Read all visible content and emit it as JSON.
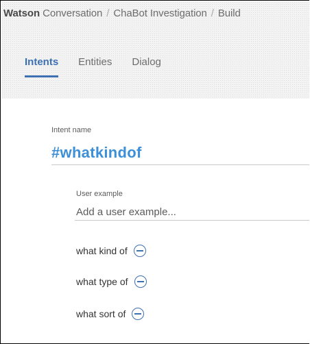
{
  "breadcrumb": {
    "brand": "Watson",
    "product": "Conversation",
    "separator": "/",
    "workspace": "ChaBot Investigation",
    "page": "Build"
  },
  "tabs": [
    {
      "label": "Intents",
      "active": true
    },
    {
      "label": "Entities",
      "active": false
    },
    {
      "label": "Dialog",
      "active": false
    }
  ],
  "intent": {
    "label": "Intent name",
    "name": "#whatkindof"
  },
  "user_example": {
    "label": "User example",
    "placeholder": "Add a user example...",
    "value": ""
  },
  "examples": [
    {
      "text": "what kind of",
      "remove_icon": "minus-circle-icon"
    },
    {
      "text": "what type of",
      "remove_icon": "minus-circle-icon"
    },
    {
      "text": "what sort of",
      "remove_icon": "minus-circle-icon"
    }
  ],
  "colors": {
    "accent": "#3d70b2",
    "intent_name": "#3d8fd8",
    "header_bg": "#f3f3f3"
  }
}
